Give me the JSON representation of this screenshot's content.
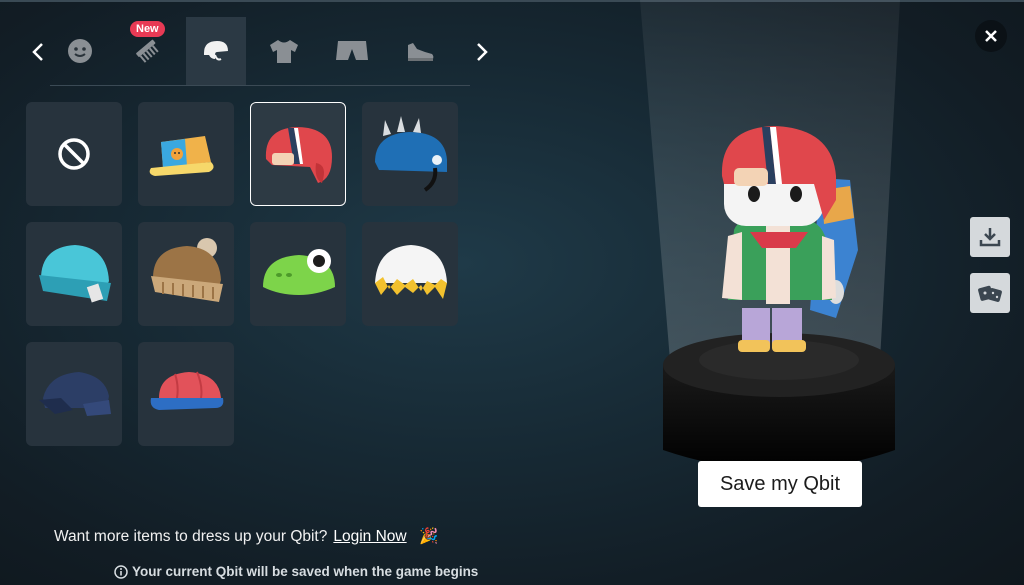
{
  "tabs": {
    "badge": "New",
    "items": [
      {
        "icon": "face-icon"
      },
      {
        "icon": "comb-icon"
      },
      {
        "icon": "helmet-icon",
        "active": true
      },
      {
        "icon": "shirt-icon"
      },
      {
        "icon": "shorts-icon"
      },
      {
        "icon": "sneaker-icon"
      }
    ]
  },
  "items": [
    {
      "name": "none"
    },
    {
      "name": "smiley-cap"
    },
    {
      "name": "red-helmet",
      "selected": true
    },
    {
      "name": "spiked-blue-helmet"
    },
    {
      "name": "teal-beanie"
    },
    {
      "name": "brown-beanie"
    },
    {
      "name": "frog-hat"
    },
    {
      "name": "snow-cap"
    },
    {
      "name": "navy-beret"
    },
    {
      "name": "red-cap"
    }
  ],
  "actions": {
    "save_label": "Save my Qbit",
    "close_icon": "close-icon",
    "download_icon": "download-icon",
    "randomize_icon": "dice-icon"
  },
  "footer": {
    "prompt": "Want more items to dress up your Qbit?",
    "login_link": "Login Now",
    "emoji": "🎉",
    "note": "Your current Qbit will be saved when the game begins"
  },
  "colors": {
    "badge": "#e83a55",
    "tile": "#27333d",
    "tab_active": "#2b3944"
  }
}
